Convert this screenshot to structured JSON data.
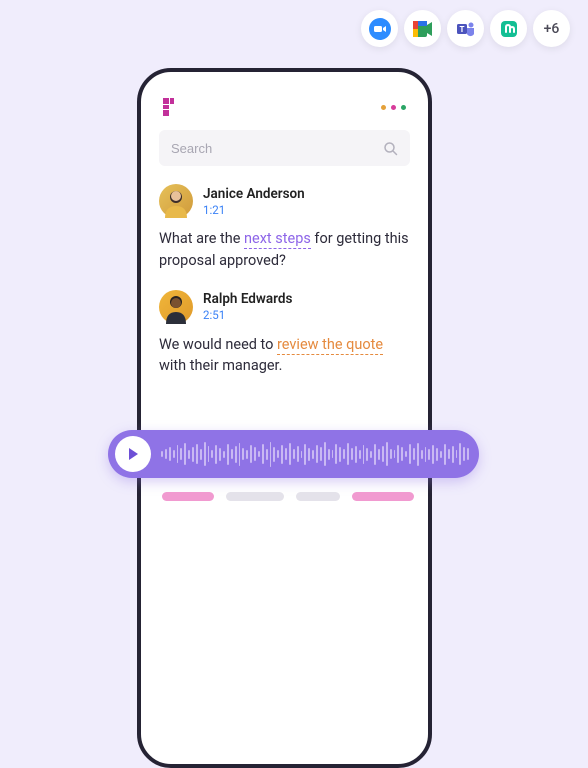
{
  "integrations": {
    "items": [
      "zoom",
      "google-meet",
      "microsoft-teams",
      "whereby"
    ],
    "more_label": "+6"
  },
  "search": {
    "placeholder": "Search"
  },
  "traffic_dots": [
    "#e4a13a",
    "#d73b9a",
    "#2aa565"
  ],
  "messages": [
    {
      "name": "Janice Anderson",
      "time": "1:21",
      "text_before": "What are the ",
      "highlight": "next steps",
      "highlight_style": "purple",
      "text_after": " for getting this proposal approved?"
    },
    {
      "name": "Ralph Edwards",
      "time": "2:51",
      "text_before": "We would need to ",
      "highlight": "review the quote",
      "highlight_style": "orange",
      "text_after": " with their manager."
    }
  ],
  "skeleton_colors": [
    "#f19ad0",
    "#e4e2ea",
    "#e4e2ea",
    "#f19ad0"
  ]
}
